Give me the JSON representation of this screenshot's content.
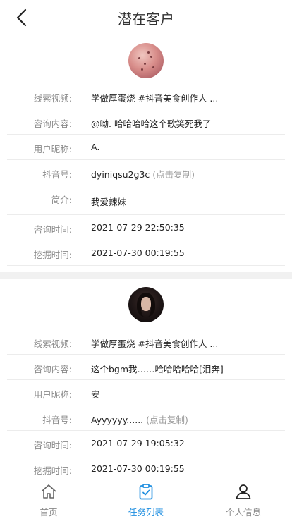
{
  "header": {
    "title": "潜在客户"
  },
  "customers": [
    {
      "rows": [
        {
          "label": "线索视频:",
          "value": "学做厚蛋烧 #抖音美食创作人 ..."
        },
        {
          "label": "咨询内容:",
          "value": "@呦. 哈哈哈哈这个歌笑死我了"
        },
        {
          "label": "用户昵称:",
          "value": "A."
        },
        {
          "label": "抖音号:",
          "value": "dyiniqsu2g3c",
          "hint": "(点击复制)"
        },
        {
          "label": "简介:",
          "value": "我爱辣妹"
        },
        {
          "label": "咨询时间:",
          "value": "2021-07-29 22:50:35"
        },
        {
          "label": "挖掘时间:",
          "value": "2021-07-30 00:19:55"
        }
      ]
    },
    {
      "rows": [
        {
          "label": "线索视频:",
          "value": "学做厚蛋烧 #抖音美食创作人 ..."
        },
        {
          "label": "咨询内容:",
          "value": "这个bgm我……哈哈哈哈哈[泪奔]"
        },
        {
          "label": "用户昵称:",
          "value": "安"
        },
        {
          "label": "抖音号:",
          "value": "Ayyyyyy......",
          "hint": "(点击复制)"
        },
        {
          "label": "咨询时间:",
          "value": "2021-07-29 19:05:32"
        },
        {
          "label": "挖掘时间:",
          "value": "2021-07-30 00:19:55"
        }
      ]
    }
  ],
  "tabbar": {
    "home": "首页",
    "tasks": "任务列表",
    "profile": "个人信息",
    "active_color": "#1e8ee0",
    "inactive_color": "#8a8a8a"
  }
}
